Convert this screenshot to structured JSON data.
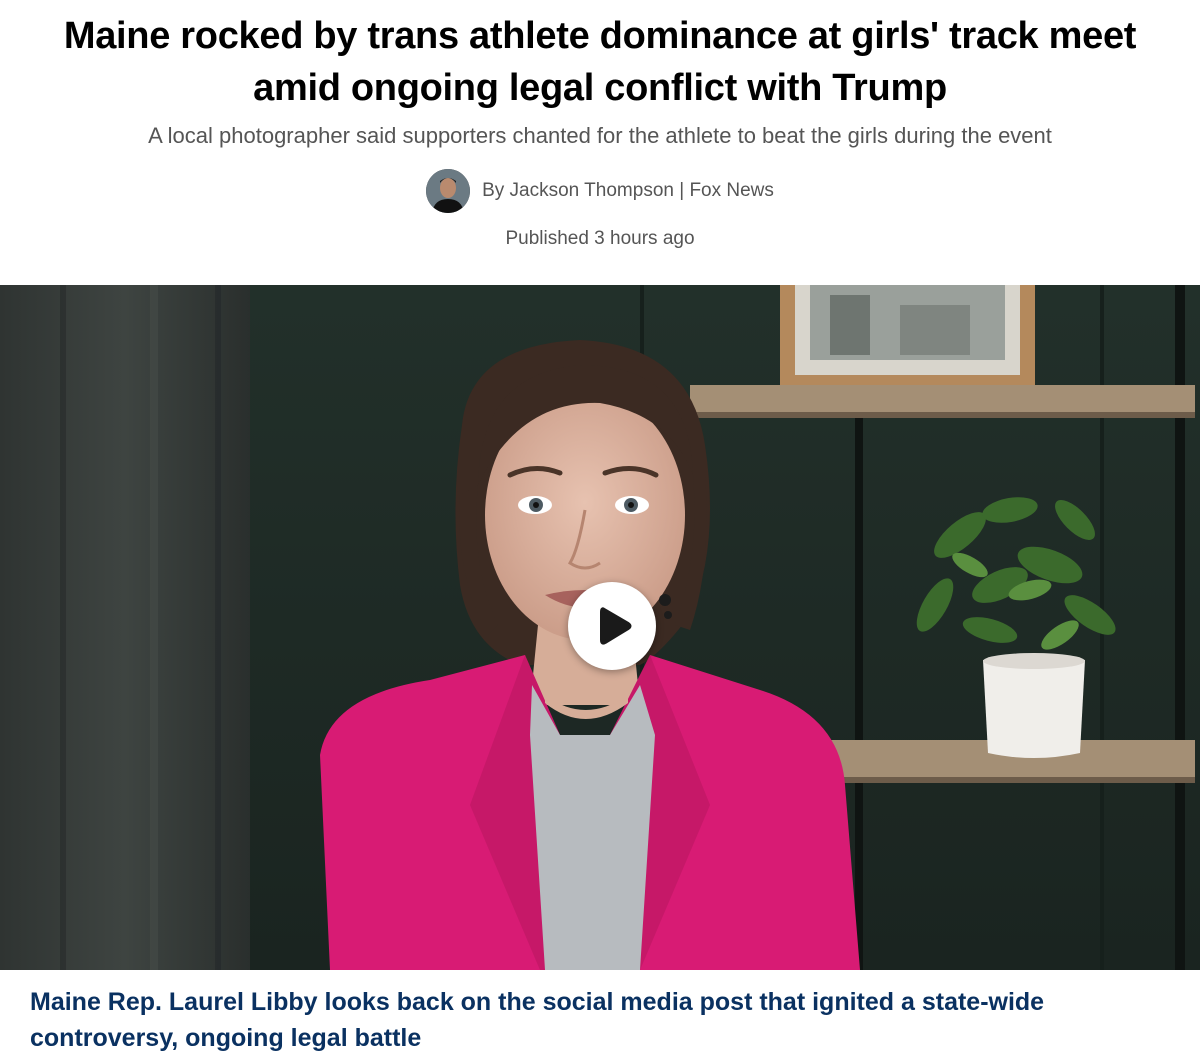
{
  "article": {
    "headline": "Maine rocked by trans athlete dominance at girls' track meet amid ongoing legal conflict with Trump",
    "subhead": "A local photographer said supporters chanted for the athlete to beat the girls during the event",
    "byline": "By Jackson Thompson | Fox News",
    "published": "Published 3 hours ago"
  },
  "video": {
    "caption": "Maine Rep. Laurel Libby looks back on the social media post that ignited a state-wide controversy, ongoing legal battle",
    "play_icon": "play-icon"
  },
  "colors": {
    "headline": "#000000",
    "meta_text": "#555555",
    "caption_text": "#0a3161",
    "jacket": "#d81b74"
  }
}
